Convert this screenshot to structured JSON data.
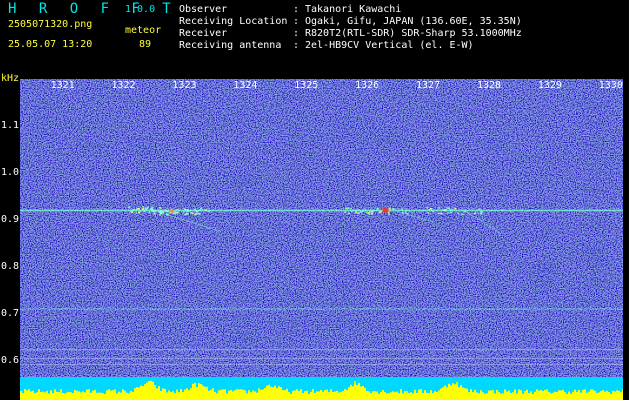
{
  "app": {
    "name": "H R O F F T",
    "version": "1.0.0"
  },
  "file": {
    "name": "2505071320.png",
    "datetime": "25.05.07 13:20"
  },
  "detection": {
    "label": "meteor",
    "count": "89"
  },
  "info": [
    {
      "key": "Observer",
      "sep": ":",
      "value": "Takanori Kawachi"
    },
    {
      "key": "Receiving Location",
      "sep": ":",
      "value": "Ogaki, Gifu, JAPAN (136.60E, 35.35N)"
    },
    {
      "key": "Receiver",
      "sep": ":",
      "value": "R820T2(RTL-SDR) SDR-Sharp 53.1000MHz"
    },
    {
      "key": "Receiving antenna",
      "sep": ":",
      "value": "2el-HB9CV Vertical (el. E-W)"
    }
  ],
  "chart_data": {
    "type": "heatmap",
    "ylabel": "kHz",
    "x_ticks": [
      "1321",
      "1322",
      "1323",
      "1324",
      "1325",
      "1326",
      "1327",
      "1328",
      "1329",
      "1330"
    ],
    "y_ticks": [
      "1.1",
      "1.0",
      "0.9",
      "0.8",
      "0.7",
      "0.6"
    ],
    "xlim": [
      1320.3,
      1330.2
    ],
    "ylim": [
      0.565,
      1.2
    ],
    "grid": false,
    "signal_lines_khz": [
      0.92,
      0.71
    ],
    "colors": {
      "background": "#000000",
      "noise_low": "#0a1aa0",
      "noise_high": "#5fb6ff",
      "signal": "#7fffd4",
      "hot": "#ff3322",
      "level_fill": "#ffff00",
      "level_base": "#00d8ff"
    }
  }
}
